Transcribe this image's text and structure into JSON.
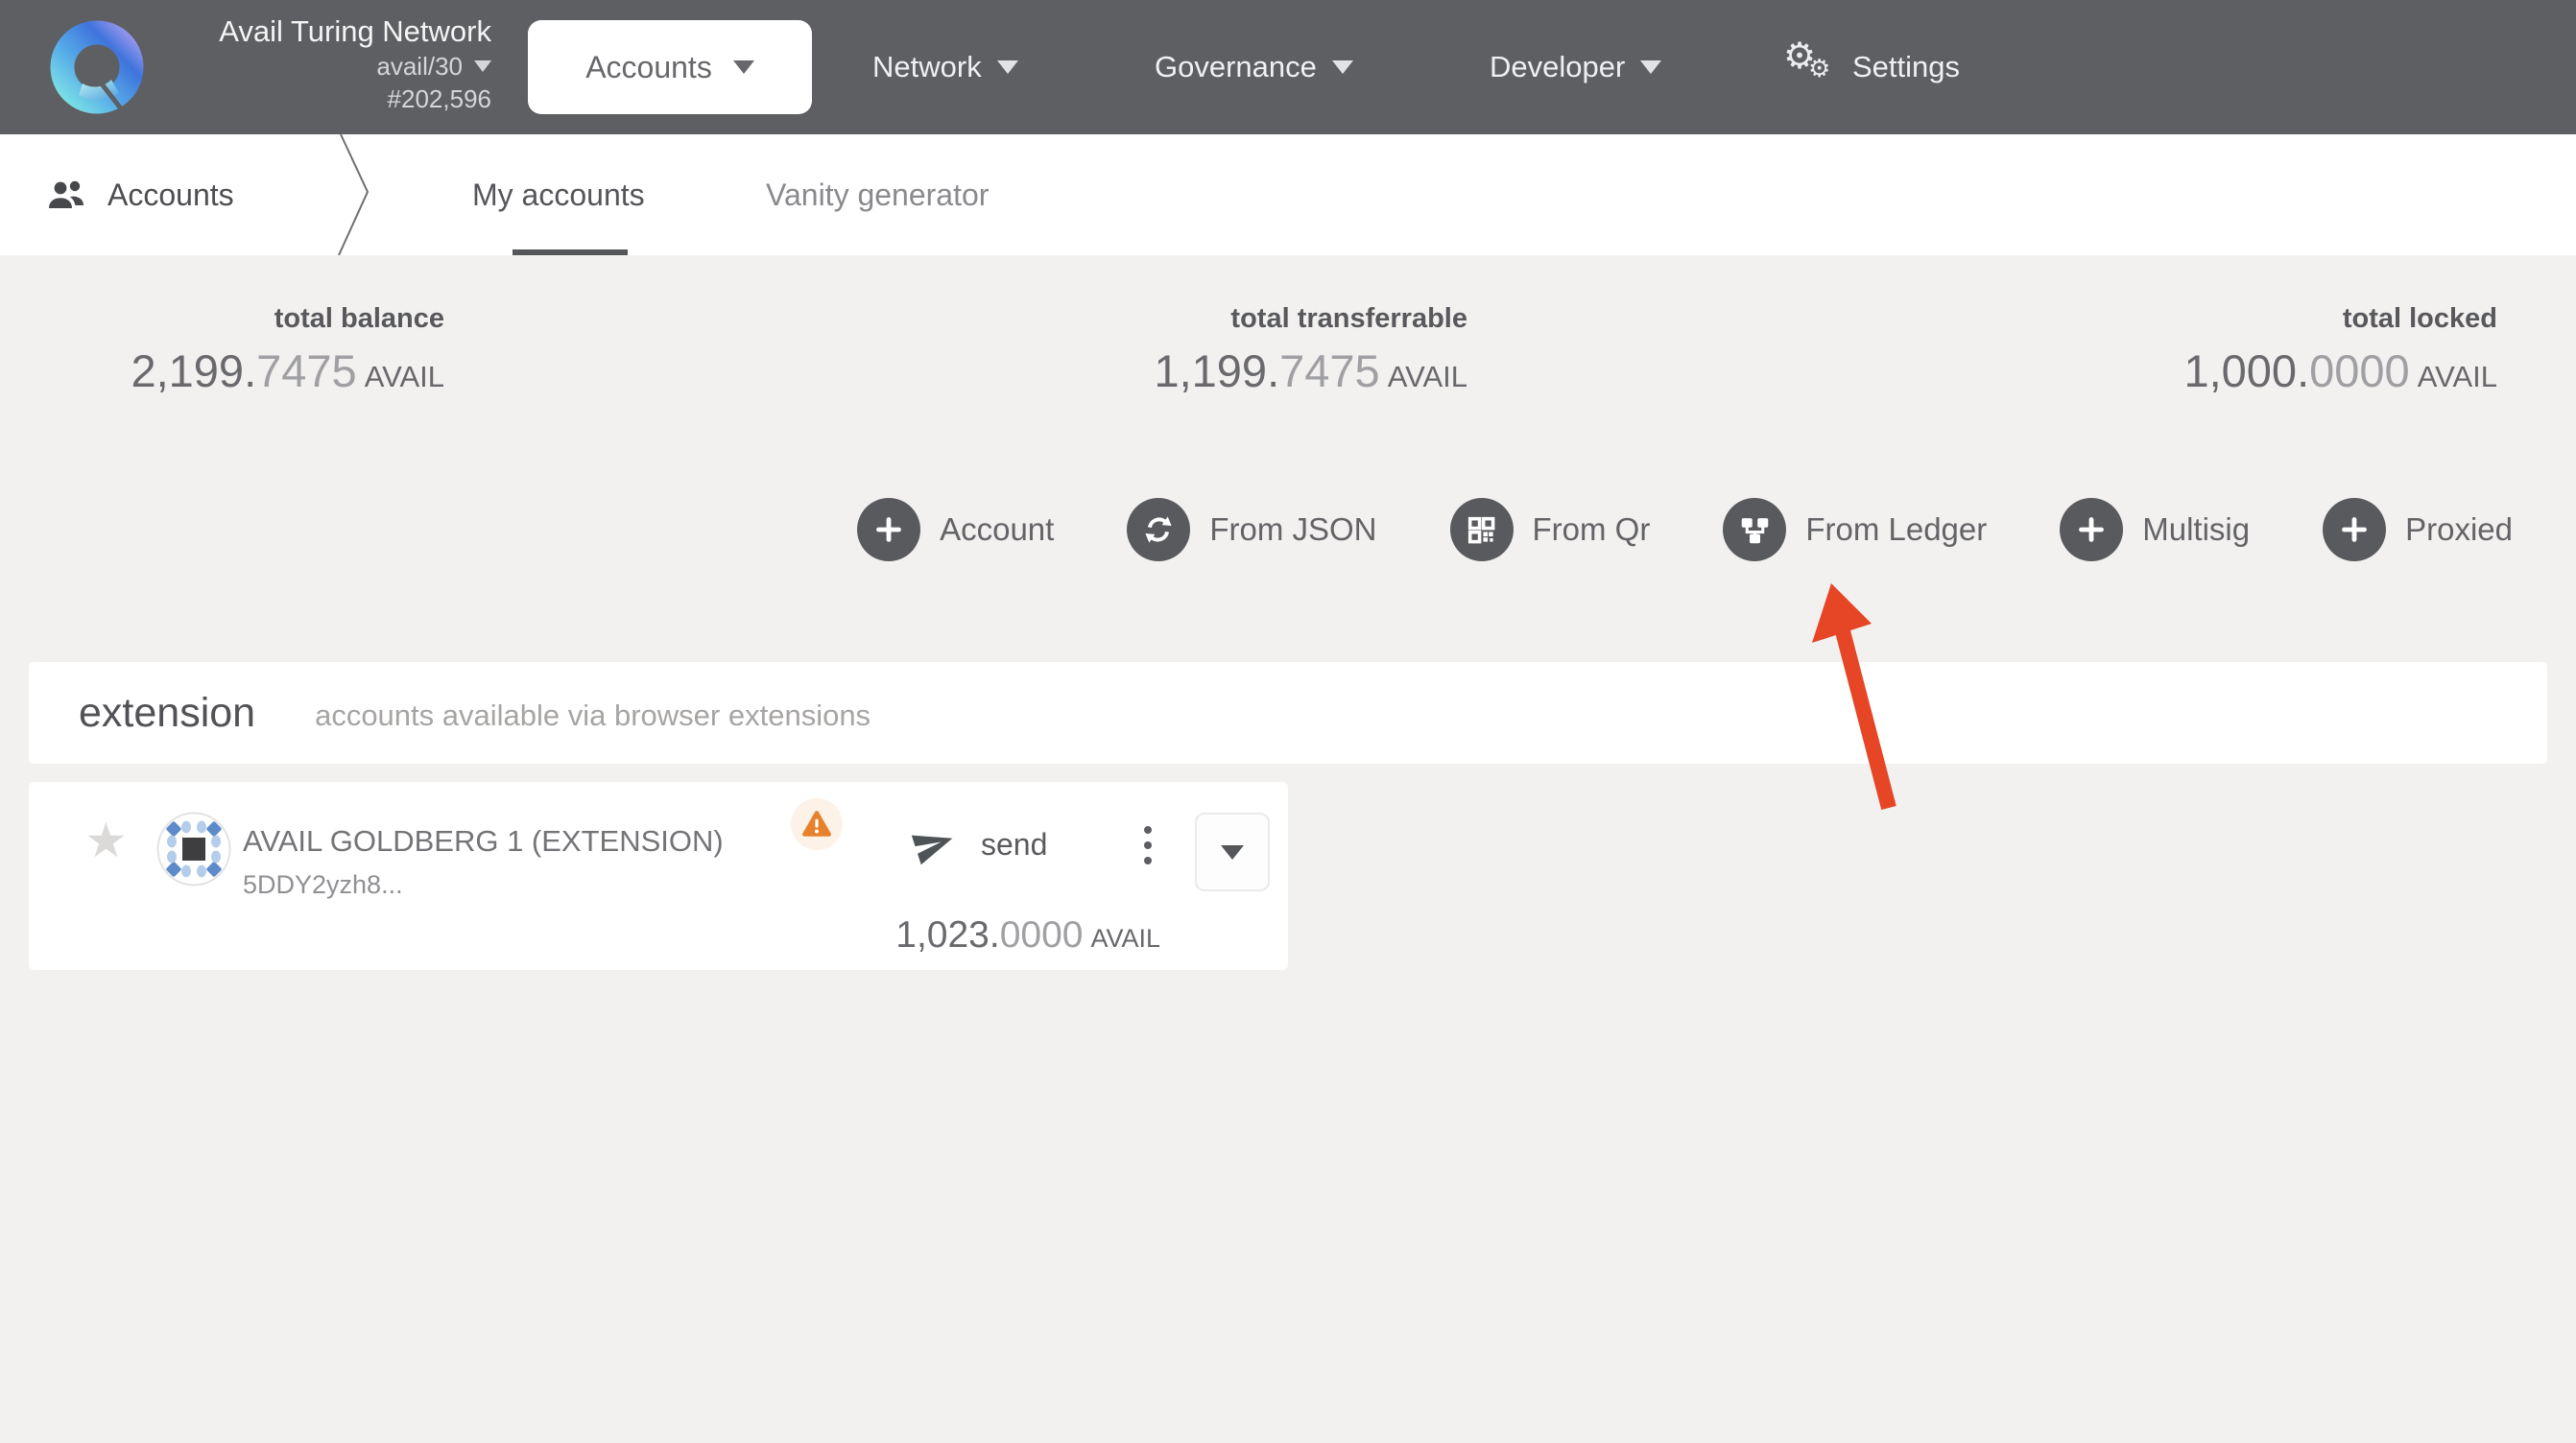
{
  "colors": {
    "header_bg": "#5e5f62",
    "page_bg": "#f2f1ef",
    "panel_bg": "#ffffff",
    "accent_orange": "#e8812c",
    "arrow_red": "#e64526",
    "action_circle": "#595a5e",
    "identicon_blue": "#5d8bc9",
    "identicon_light_blue": "#b4cdea"
  },
  "icons": {
    "star": "★",
    "gear": "⚙"
  },
  "header": {
    "network_name": "Avail Turing Network",
    "spec": "avail/30",
    "block": "#202,596",
    "menu_accounts": "Accounts",
    "menu_network": "Network",
    "menu_governance": "Governance",
    "menu_developer": "Developer",
    "menu_settings": "Settings"
  },
  "subnav": {
    "section": "Accounts",
    "tab_my_accounts": "My accounts",
    "tab_vanity": "Vanity generator"
  },
  "summary": {
    "balance": {
      "label": "total balance",
      "int": "2,199.",
      "frac": "7475",
      "unit": "AVAIL"
    },
    "transferrable": {
      "label": "total transferrable",
      "int": "1,199.",
      "frac": "7475",
      "unit": "AVAIL"
    },
    "locked": {
      "label": "total locked",
      "int": "1,000.",
      "frac": "0000",
      "unit": "AVAIL"
    }
  },
  "actions": {
    "account": "Account",
    "from_json": "From JSON",
    "from_qr": "From Qr",
    "from_ledger": "From Ledger",
    "multisig": "Multisig",
    "proxied": "Proxied"
  },
  "extension": {
    "title": "extension",
    "subtitle": "accounts available via browser extensions"
  },
  "account_row": {
    "name": "AVAIL GOLDBERG 1 (EXTENSION)",
    "address": "5DDY2yzh8...",
    "send": "send",
    "balance_int": "1,023.",
    "balance_frac": "0000",
    "balance_unit": "AVAIL"
  }
}
